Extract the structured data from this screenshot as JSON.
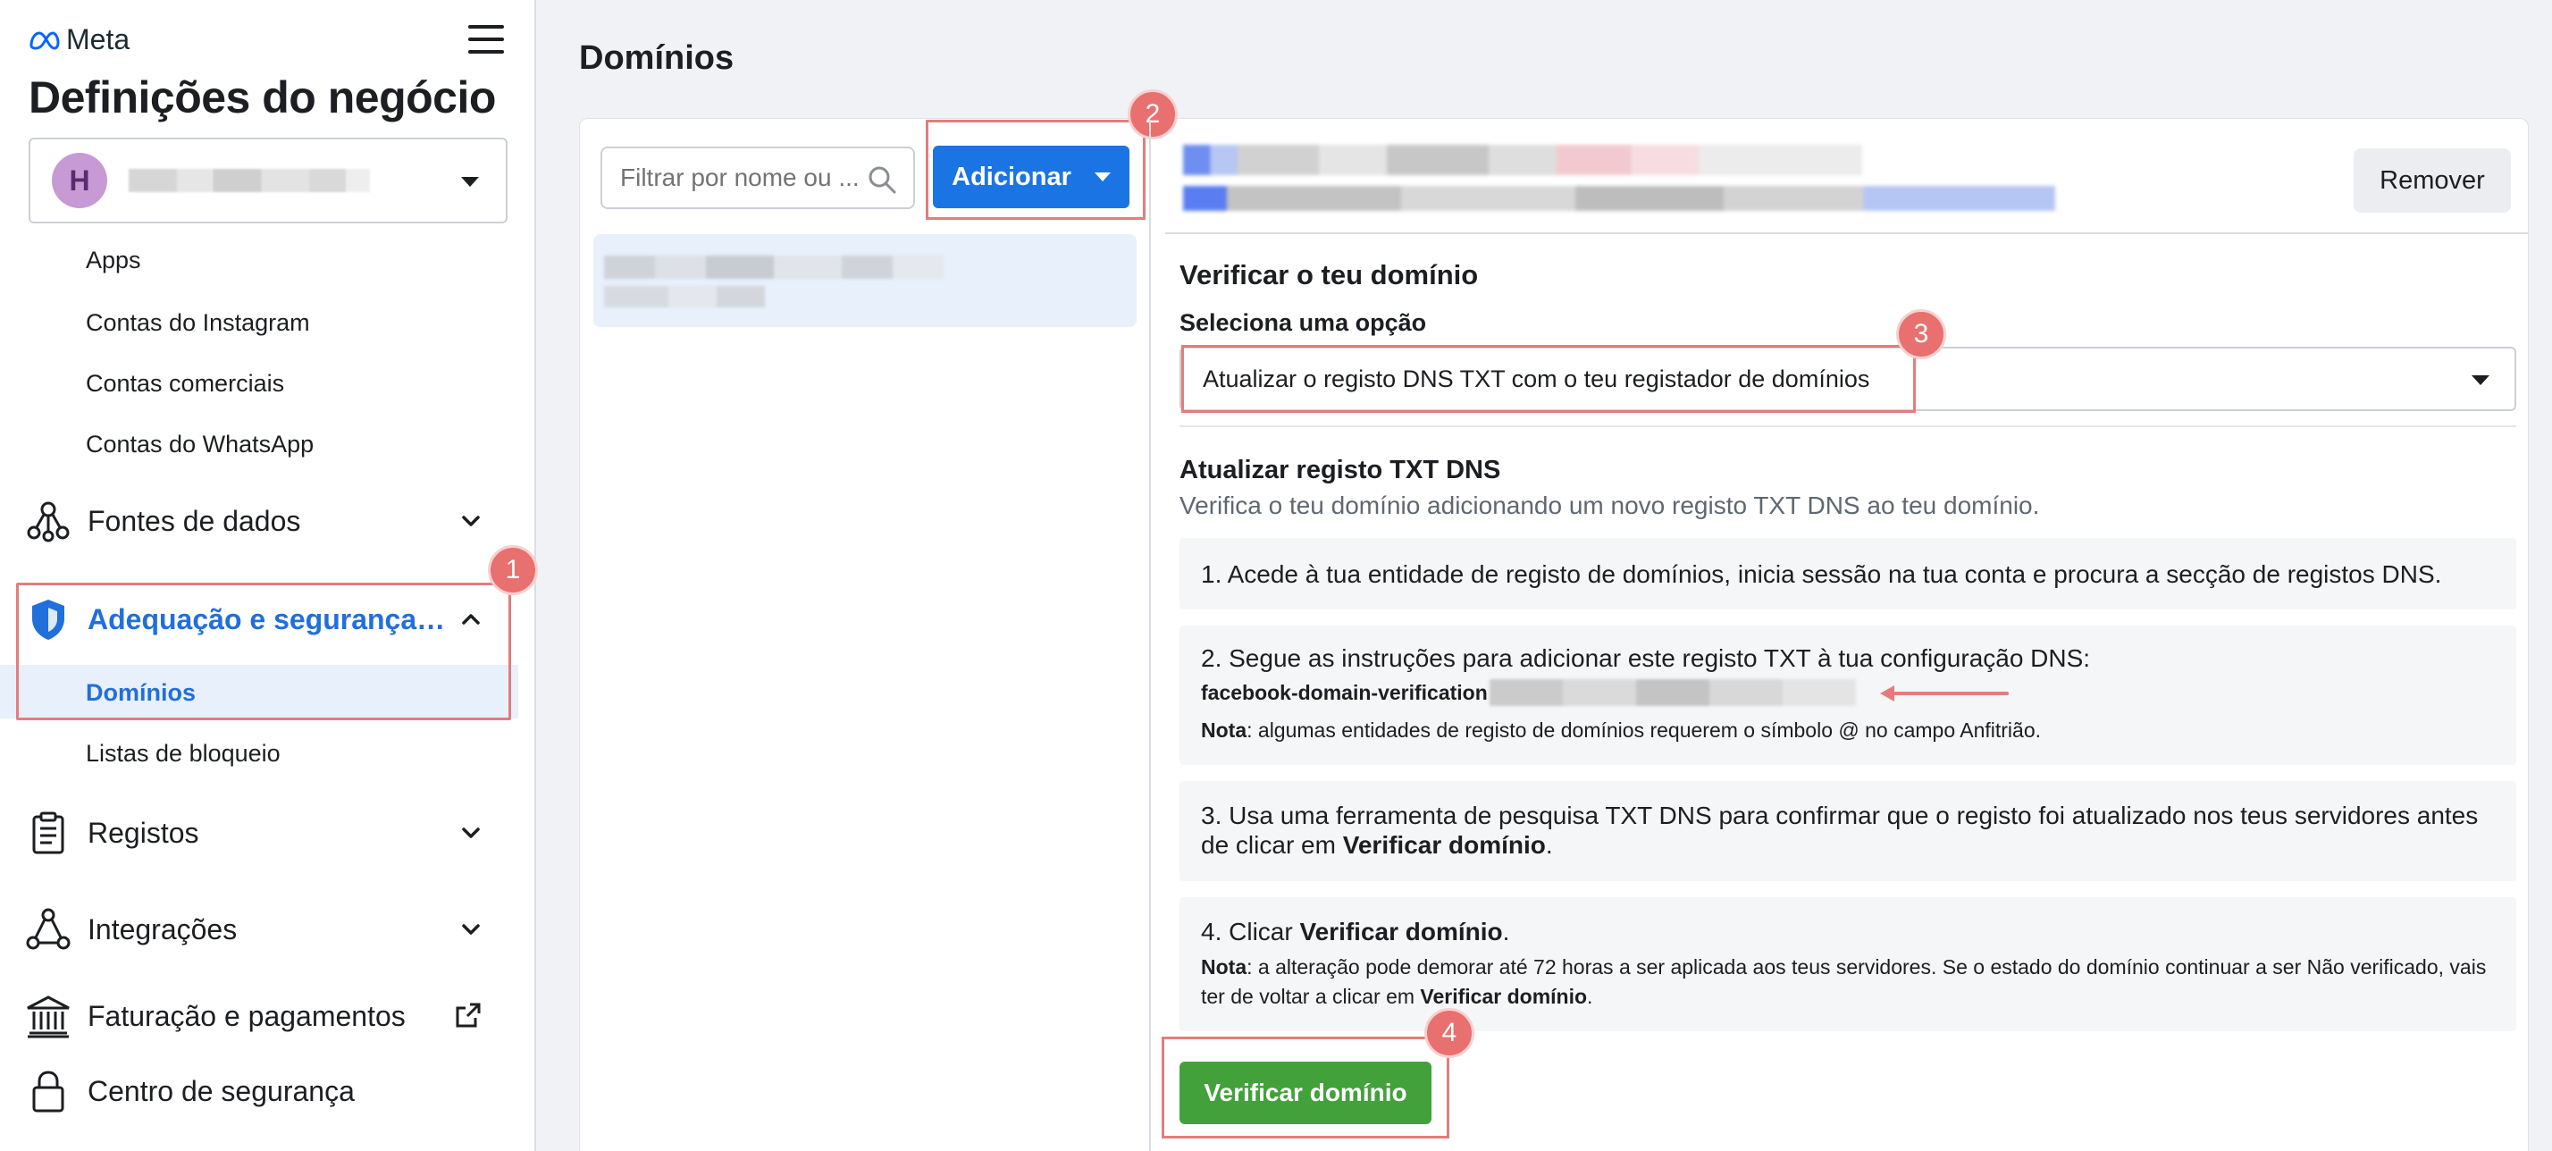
{
  "sidebar": {
    "brand": "Meta",
    "title": "Definições do negócio",
    "account": {
      "avatar_letter": "H"
    },
    "sub_items_top": [
      "Apps",
      "Contas do Instagram",
      "Contas comerciais",
      "Contas do WhatsApp"
    ],
    "nav": {
      "data_sources": "Fontes de dados",
      "brand_safety": "Adequação e segurança…",
      "registos": "Registos",
      "integrations": "Integrações",
      "billing": "Faturação e pagamentos",
      "security_center": "Centro de segurança"
    },
    "brand_safety_sub": {
      "domains": "Domínios",
      "block_lists": "Listas de bloqueio"
    }
  },
  "badges": [
    "1",
    "2",
    "3",
    "4"
  ],
  "main": {
    "page_title": "Domínios",
    "filter_placeholder": "Filtrar por nome ou ...",
    "add_button": "Adicionar",
    "remove_button": "Remover",
    "verify_title": "Verificar o teu domínio",
    "select_label": "Seleciona uma opção",
    "selected_option": "Atualizar o registo DNS TXT com o teu registador de domínios",
    "txt_title": "Atualizar registo TXT DNS",
    "txt_desc": "Verifica o teu domínio adicionando um novo registo TXT DNS ao teu domínio.",
    "steps": {
      "s1": "1. Acede à tua entidade de registo de domínios, inicia sessão na tua conta e procura a secção de registos DNS.",
      "s2": "2. Segue as instruções para adicionar este registo TXT à tua configuração DNS:",
      "s2_key": "facebook-domain-verification",
      "s2_note_label": "Nota",
      "s2_note": ": algumas entidades de registo de domínios requerem o símbolo @ no campo Anfitrião.",
      "s3_pre": "3. Usa uma ferramenta de pesquisa TXT DNS para confirmar que o registo foi atualizado nos teus servidores antes de clicar em ",
      "s3_bold": "Verificar domínio",
      "s3_post": ".",
      "s4_pre": "4. Clicar ",
      "s4_bold": "Verificar domínio",
      "s4_post": ".",
      "s4_note_label": "Nota",
      "s4_note_pre": ": a alteração pode demorar até 72 horas a ser aplicada aos teus servidores. Se o estado do domínio continuar a ser Não verificado, vais ter de voltar a clicar em ",
      "s4_note_bold": "Verificar domínio",
      "s4_note_post": "."
    },
    "verify_button": "Verificar domínio"
  },
  "colors": {
    "accent_blue": "#1b74e4",
    "active_text": "#216fdb",
    "verify_green": "#42a13a",
    "highlight_red": "#e37d7d",
    "badge_red": "#e8706f"
  },
  "icons": [
    "meta-logo-icon",
    "hamburger-icon",
    "data-sources-icon",
    "shield-icon",
    "clipboard-icon",
    "integrations-icon",
    "bank-icon",
    "external-link-icon",
    "lock-icon",
    "search-icon",
    "chevron-down-icon",
    "chevron-up-icon",
    "arrow-left-icon"
  ]
}
